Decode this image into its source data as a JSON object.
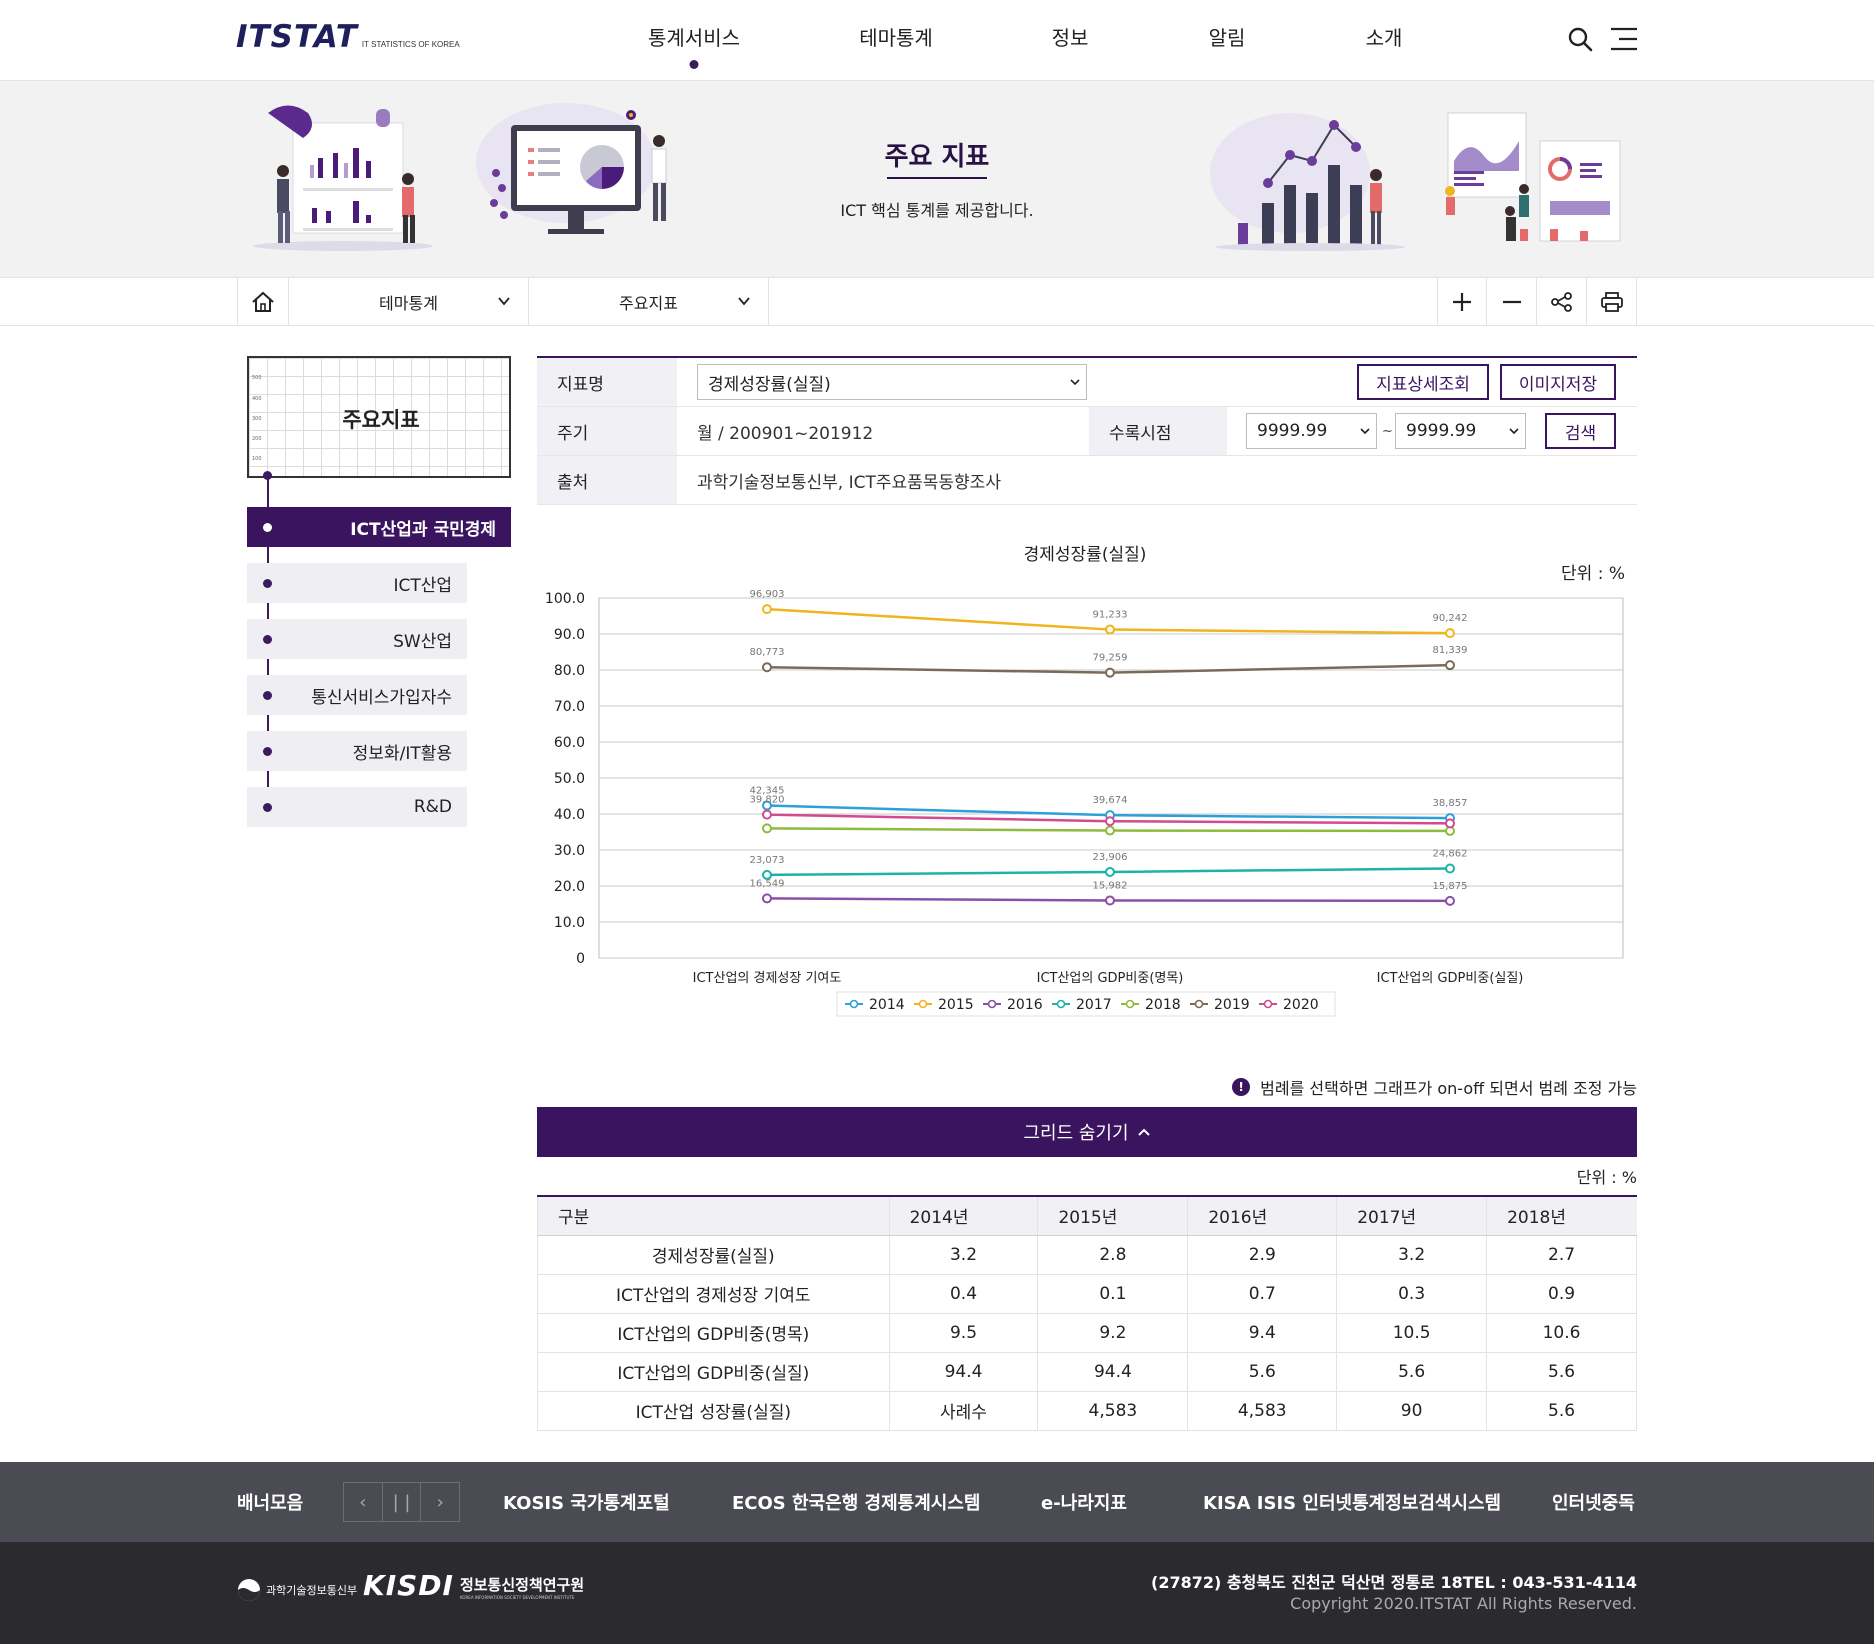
{
  "header": {
    "logo": "ITSTAT",
    "logo_sub": "IT STATISTICS OF KOREA",
    "nav": [
      "통계서비스",
      "테마통계",
      "정보",
      "알림",
      "소개"
    ],
    "active_nav": "통계서비스",
    "icons": [
      "search-icon",
      "menu-icon"
    ]
  },
  "hero": {
    "title": "주요 지표",
    "subtitle": "ICT 핵심 통계를 제공합니다."
  },
  "location": {
    "home_icon": "home-icon",
    "level1": "테마통계",
    "level2": "주요지표",
    "tools": [
      "zoom-in-icon",
      "zoom-out-icon",
      "share-icon",
      "print-icon"
    ]
  },
  "sidebar": {
    "card_title": "주요지표",
    "card_axis": [
      "500",
      "400",
      "300",
      "200",
      "100"
    ],
    "items": [
      {
        "label": "ICT산업과 국민경제",
        "active": true
      },
      {
        "label": "ICT산업",
        "active": false
      },
      {
        "label": "SW산업",
        "active": false
      },
      {
        "label": "통신서비스가입자수",
        "active": false
      },
      {
        "label": "정보화/IT활용",
        "active": false
      },
      {
        "label": "R&D",
        "active": false
      }
    ]
  },
  "filter": {
    "indicator_label": "지표명",
    "indicator_value": "경제성장률(실질)",
    "detail_button": "지표상세조회",
    "image_button": "이미지저장",
    "period_label": "주기",
    "period_value": "월 / 200901~201912",
    "collect_label": "수록시점",
    "from_value": "9999.99",
    "tilde": "~",
    "to_value": "9999.99",
    "search_button": "검색",
    "source_label": "출처",
    "source_value": "과학기술정보통신부, ICT주요품목동향조사"
  },
  "chart_data": {
    "type": "line",
    "title": "경제성장률(실질)",
    "unit": "단위 : %",
    "categories": [
      "ICT산업의 경제성장 기여도",
      "ICT산업의 GDP비중(명목)",
      "ICT산업의 GDP비중(실질)"
    ],
    "ylim": [
      0,
      100
    ],
    "yticks": [
      "0",
      "10.0",
      "20.0",
      "30.0",
      "40.0",
      "50.0",
      "60.0",
      "70.0",
      "80.0",
      "90.0",
      "100.0"
    ],
    "grid": true,
    "legend_position": "bottom",
    "series": [
      {
        "name": "2014",
        "color": "#2f9fd8",
        "values": [
          42.345,
          39.674,
          38.857
        ],
        "labels": [
          "42,345",
          "39,674",
          "38,857"
        ]
      },
      {
        "name": "2015",
        "color": "#f0b41c",
        "values": [
          96.903,
          91.233,
          90.242
        ],
        "labels": [
          "96,903",
          "91,233",
          "90,242"
        ]
      },
      {
        "name": "2016",
        "color": "#8c4fa8",
        "values": [
          16.549,
          15.982,
          15.875
        ],
        "labels": [
          "16,549",
          "15,982",
          "15,875"
        ]
      },
      {
        "name": "2017",
        "color": "#1fb3a5",
        "values": [
          23.073,
          23.906,
          24.862
        ],
        "labels": [
          "23,073",
          "23,906",
          "24,862"
        ]
      },
      {
        "name": "2018",
        "color": "#8dbb3c",
        "values": [
          36.0,
          35.4,
          35.3
        ],
        "labels": [
          "",
          "",
          ""
        ]
      },
      {
        "name": "2019",
        "color": "#7a6a5a",
        "values": [
          80.773,
          79.259,
          81.339
        ],
        "labels": [
          "80,773",
          "79,259",
          "81,339"
        ]
      },
      {
        "name": "2020",
        "color": "#d14b8f",
        "values": [
          39.82,
          38.0,
          37.4
        ],
        "labels": [
          "39,820",
          "",
          ""
        ]
      }
    ]
  },
  "notice": "범례를 선택하면 그래프가 on-off 되면서 범례 조정 가능",
  "grid_toggle": "그리드 숨기기",
  "table": {
    "unit": "단위 : %",
    "headers": [
      "구분",
      "2014년",
      "2015년",
      "2016년",
      "2017년",
      "2018년"
    ],
    "rows": [
      [
        "경제성장률(실질)",
        "3.2",
        "2.8",
        "2.9",
        "3.2",
        "2.7"
      ],
      [
        "ICT산업의 경제성장 기여도",
        "0.4",
        "0.1",
        "0.7",
        "0.3",
        "0.9"
      ],
      [
        "ICT산업의 GDP비중(명목)",
        "9.5",
        "9.2",
        "9.4",
        "10.5",
        "10.6"
      ],
      [
        "ICT산업의 GDP비중(실질)",
        "94.4",
        "94.4",
        "5.6",
        "5.6",
        "5.6"
      ],
      [
        "ICT산업 성장률(실질)",
        "사례수",
        "4,583",
        "4,583",
        "90",
        "5.6"
      ]
    ]
  },
  "banner": {
    "title": "배너모음",
    "controls": [
      "‹",
      "| |",
      "›"
    ],
    "links": [
      "KOSIS 국가통계포털",
      "ECOS 한국은행 경제통계시스템",
      "e-나라지표",
      "KISA ISIS 인터넷통계정보검색시스템",
      "인터넷중독"
    ]
  },
  "footer": {
    "org1": "과학기술정보통신부",
    "org2": "KISDI",
    "org2_name": "정보통신정책연구원",
    "org2_sub": "KOREA INFORMATION SOCIETY DEVELOPMENT INSTITUTE",
    "address": "(27872) 충청북도 진천군 덕산면 정통로 18TEL : 043-531-4114",
    "copyright": "Copyright 2020.ITSTAT All Rights Reserved."
  }
}
